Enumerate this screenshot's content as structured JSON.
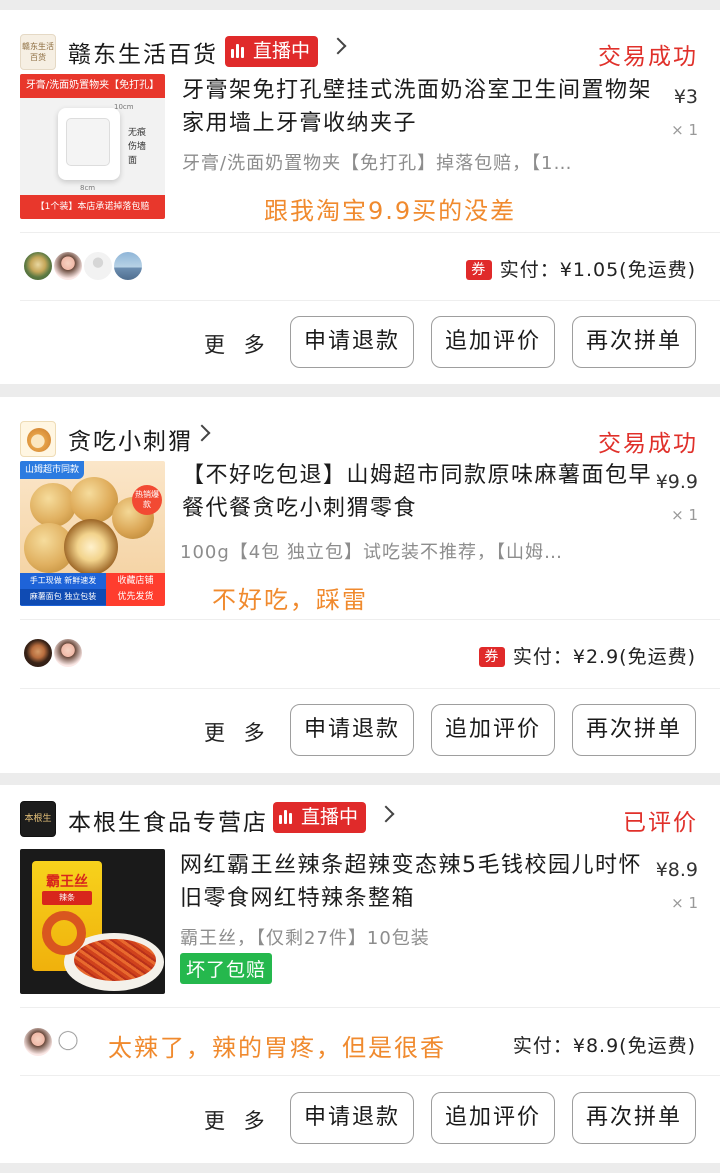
{
  "common": {
    "more_label": "更 多",
    "refund_label": "申请退款",
    "review_label": "追加评价",
    "reorder_label": "再次拼单"
  },
  "orders": [
    {
      "shop_name": "赣东生活百货",
      "shop_logo_text": "赣东生活百货",
      "live_label": "直播中",
      "status": "交易成功",
      "product_title": "牙膏架免打孔壁挂式洗面奶浴室卫生间置物架家用墙上牙膏收纳夹子",
      "price": "¥3",
      "qty": "× 1",
      "spec": "牙膏/洗面奶置物夹【免打孔】掉落包赔，【1…",
      "comment": "跟我淘宝9.9买的没差",
      "coupon": "券",
      "paid": "实付：¥1.05(免运费)",
      "thumb": {
        "top_banner": "牙膏/洗面奶置物夹【免打孔】",
        "bottom_banner": "【1个装】本店承诺掉落包赔",
        "side_text": "无痕伤墙面",
        "dim1": "10cm",
        "dim2": "8cm"
      }
    },
    {
      "shop_name": "贪吃小刺猬",
      "status": "交易成功",
      "product_title": "【不好吃包退】山姆超市同款原味麻薯面包早餐代餐贪吃小刺猬零食",
      "price": "¥9.9",
      "qty": "× 1",
      "spec": "100g【4包 独立包】试吃装不推荐，【山姆…",
      "comment": "不好吃，踩雷",
      "coupon": "券",
      "paid": "实付：¥2.9(免运费)",
      "thumb": {
        "top_tag": "山姆超市同款",
        "hot_tag": "热销爆款",
        "bottom_left": "手工现做 新鲜速发",
        "bottom_left2": "麻薯面包 独立包装",
        "bottom_right": "收藏店铺",
        "bottom_right2": "优先发货"
      }
    },
    {
      "shop_name": "本根生食品专营店",
      "shop_logo_text": "本根生",
      "live_label": "直播中",
      "status": "已评价",
      "product_title": "网红霸王丝辣条超辣变态辣5毛钱校园儿时怀旧零食网红特辣条整箱",
      "price": "¥8.9",
      "qty": "× 1",
      "spec": "霸王丝，【仅剩27件】10包装",
      "guarantee": "坏了包赔",
      "comment": "太辣了，辣的胃疼，但是很香",
      "paid": "实付：¥8.9(免运费)",
      "thumb": {
        "brand": "霸王丝",
        "sub": "辣条"
      }
    }
  ]
}
